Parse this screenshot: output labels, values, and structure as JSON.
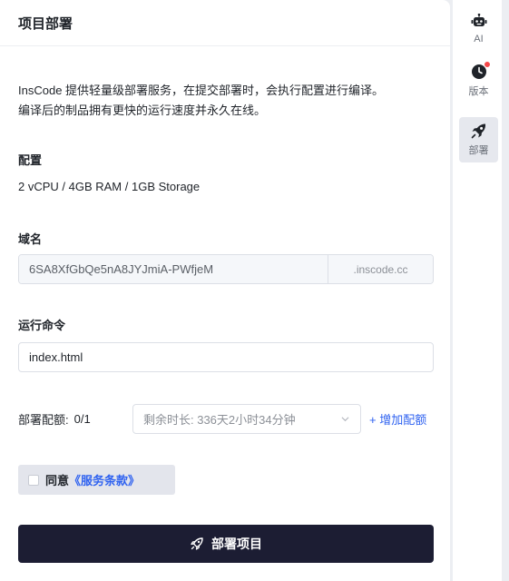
{
  "panel": {
    "title": "项目部署",
    "description_line1": "InsCode 提供轻量级部署服务，在提交部署时，会执行配置进行编译。",
    "description_line2": "编译后的制品拥有更快的运行速度并永久在线。"
  },
  "config": {
    "label": "配置",
    "value": "2 vCPU / 4GB RAM / 1GB Storage"
  },
  "domain": {
    "label": "域名",
    "value": "6SA8XfGbQe5nA8JYJmiA-PWfjeM",
    "suffix": ".inscode.cc"
  },
  "command": {
    "label": "运行命令",
    "value": "index.html"
  },
  "quota": {
    "label": "部署配额:",
    "count": "0/1",
    "remaining": "剩余时长: 336天2小时34分钟",
    "add_label": "+ 增加配额"
  },
  "agreement": {
    "prefix": "同意",
    "terms_link": "《服务条款》"
  },
  "deploy_button": {
    "label": "部署项目"
  },
  "rail": {
    "items": [
      {
        "label": "AI",
        "icon": "robot-icon"
      },
      {
        "label": "版本",
        "icon": "clock-icon",
        "has_badge": true
      },
      {
        "label": "部署",
        "icon": "rocket-icon",
        "active": true
      }
    ]
  },
  "colors": {
    "primary_dark": "#1c1d33",
    "link_blue": "#2f62f0",
    "badge_red": "#f5484a"
  }
}
